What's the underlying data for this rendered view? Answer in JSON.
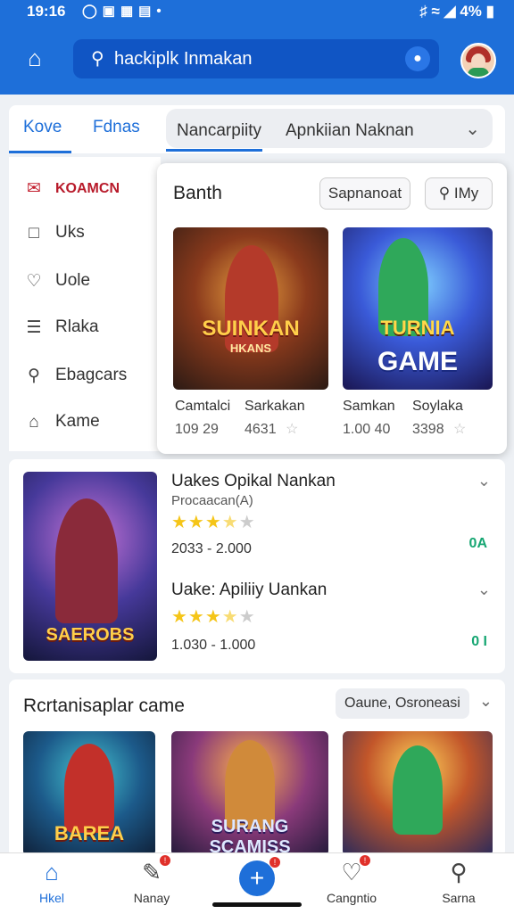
{
  "status": {
    "time": "19:16",
    "battery": "4%"
  },
  "search": {
    "query": "hackiplk Inmakan"
  },
  "tabs": {
    "t1": "Kove",
    "t2": "Fdnas",
    "g1": "Nancarpiity",
    "g2": "Apnkiian Naknan"
  },
  "sidebar": {
    "items": [
      {
        "label": "KOAMCN",
        "icon": "mail-icon"
      },
      {
        "label": "Uks",
        "icon": "file-icon"
      },
      {
        "label": "Uole",
        "icon": "heart-icon"
      },
      {
        "label": "Rlaka",
        "icon": "list-icon"
      },
      {
        "label": "Ebagcars",
        "icon": "person-icon"
      },
      {
        "label": "Kame",
        "icon": "home-icon"
      }
    ]
  },
  "panel": {
    "title": "Banth",
    "btn1": "Sapnanoat",
    "btn2": "IMy",
    "games": [
      {
        "art_label": "SUINKAN",
        "art_sub": "HKANS",
        "name_a": "Camtalci",
        "num_a": "109 29",
        "name_b": "Sarkakan",
        "num_b": "4631"
      },
      {
        "art_label": "TURNIA",
        "art_sub": "GAME",
        "name_a": "Samkan",
        "num_a": "1.00 40",
        "name_b": "Soylaka",
        "num_b": "3398"
      }
    ]
  },
  "list": {
    "thumb_label": "SAEROBS",
    "items": [
      {
        "title": "Uakes Opikal Nankan",
        "sub": "Procaacan(A)",
        "stars": 3.5,
        "range": "2033 - 2.000",
        "badge": "0A"
      },
      {
        "title": "Uake: Apiliiy Uankan",
        "sub": "",
        "stars": 3.5,
        "range": "1.030 - 1.000",
        "badge": "0 I"
      }
    ]
  },
  "recs": {
    "title": "Rcrtanisaplar came",
    "filter1": "Oaune,",
    "filter2": "Osroneasi",
    "thumbs": [
      "BAREA",
      "SURANG SCAMISS",
      "",
      ""
    ]
  },
  "nav": [
    {
      "label": "Hkel",
      "icon": "home-icon"
    },
    {
      "label": "Nanay",
      "icon": "edit-icon"
    },
    {
      "label": "",
      "icon": "plus-icon"
    },
    {
      "label": "Cangntio",
      "icon": "heart-icon"
    },
    {
      "label": "Sarna",
      "icon": "person-icon"
    }
  ]
}
